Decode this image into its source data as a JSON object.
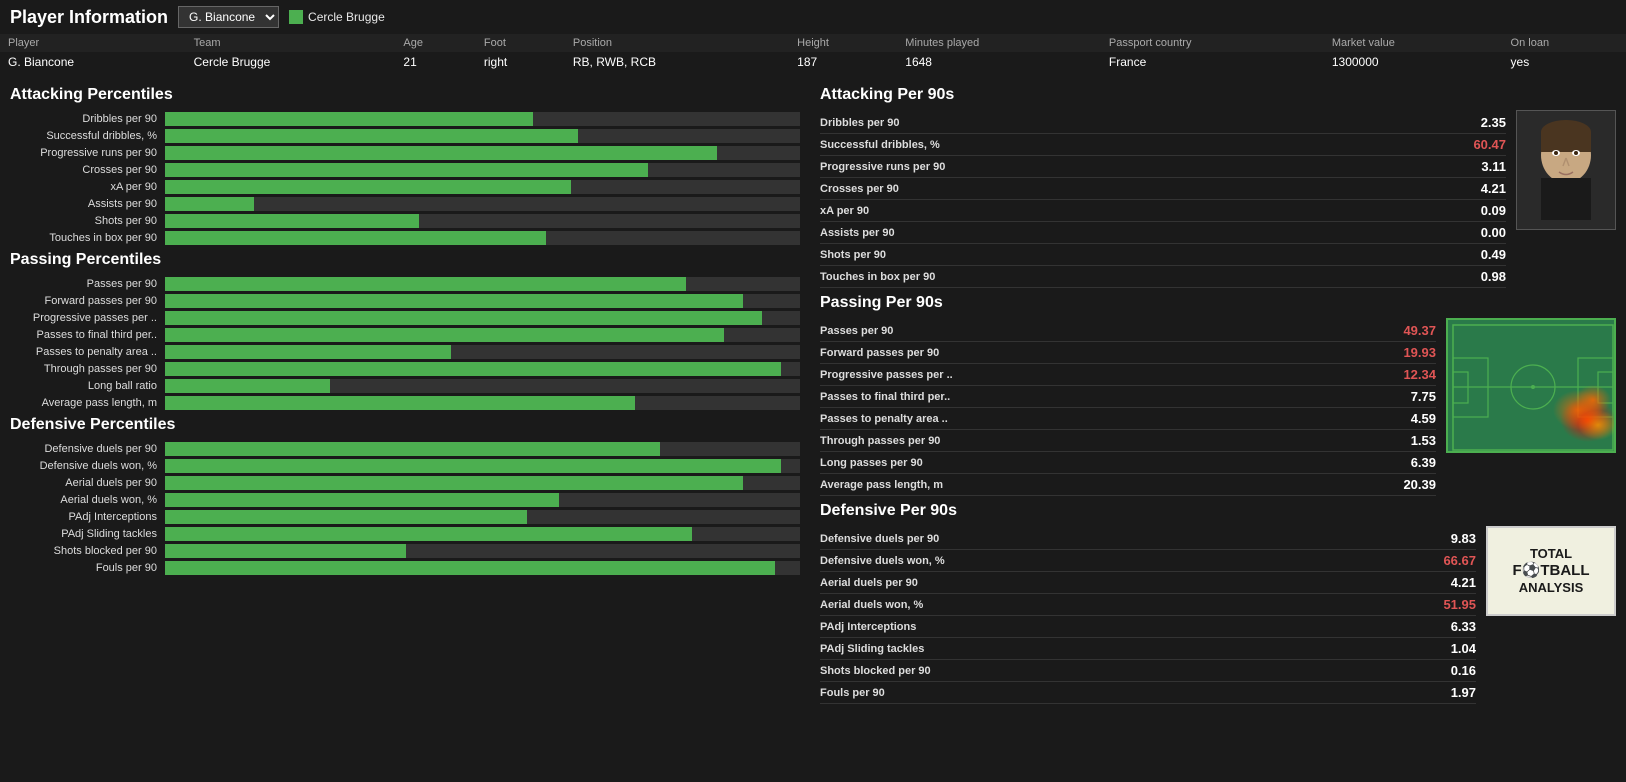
{
  "header": {
    "title": "Player Information",
    "player_selector": "G. Biancone",
    "team_name": "Cercle Brugge"
  },
  "player_info": {
    "labels": [
      "Player",
      "Team",
      "Age",
      "Foot",
      "Position",
      "Height",
      "Minutes played",
      "Passport country",
      "Market value",
      "On loan"
    ],
    "values": [
      "G. Biancone",
      "Cercle Brugge",
      "21",
      "right",
      "RB, RWB, RCB",
      "187",
      "1648",
      "France",
      "1300000",
      "yes"
    ]
  },
  "attacking_percentiles": {
    "title": "Attacking Percentiles",
    "bars": [
      {
        "label": "Dribbles per 90",
        "pct": 58
      },
      {
        "label": "Successful dribbles, %",
        "pct": 65
      },
      {
        "label": "Progressive runs per 90",
        "pct": 87
      },
      {
        "label": "Crosses per 90",
        "pct": 76
      },
      {
        "label": "xA per 90",
        "pct": 64
      },
      {
        "label": "Assists per 90",
        "pct": 14
      },
      {
        "label": "Shots per 90",
        "pct": 40
      },
      {
        "label": "Touches in box per 90",
        "pct": 60
      }
    ]
  },
  "attacking_per90": {
    "title": "Attacking Per 90s",
    "stats": [
      {
        "label": "Dribbles per 90",
        "value": "2.35",
        "red": false
      },
      {
        "label": "Successful dribbles, %",
        "value": "60.47",
        "red": true
      },
      {
        "label": "Progressive runs per 90",
        "value": "3.11",
        "red": false
      },
      {
        "label": "Crosses per 90",
        "value": "4.21",
        "red": false
      },
      {
        "label": "xA per 90",
        "value": "0.09",
        "red": false
      },
      {
        "label": "Assists per 90",
        "value": "0.00",
        "red": false
      },
      {
        "label": "Shots per 90",
        "value": "0.49",
        "red": false
      },
      {
        "label": "Touches in box per 90",
        "value": "0.98",
        "red": false
      }
    ]
  },
  "passing_percentiles": {
    "title": "Passing Percentiles",
    "bars": [
      {
        "label": "Passes per 90",
        "pct": 82
      },
      {
        "label": "Forward passes per 90",
        "pct": 91
      },
      {
        "label": "Progressive passes per ..",
        "pct": 94
      },
      {
        "label": "Passes to final third per..",
        "pct": 88
      },
      {
        "label": "Passes to penalty area ..",
        "pct": 45
      },
      {
        "label": "Through passes per 90",
        "pct": 97
      },
      {
        "label": "Long ball ratio",
        "pct": 26
      },
      {
        "label": "Average pass length, m",
        "pct": 74
      }
    ]
  },
  "passing_per90": {
    "title": "Passing Per 90s",
    "stats": [
      {
        "label": "Passes per 90",
        "value": "49.37",
        "red": true
      },
      {
        "label": "Forward passes per 90",
        "value": "19.93",
        "red": true
      },
      {
        "label": "Progressive passes per ..",
        "value": "12.34",
        "red": true
      },
      {
        "label": "Passes to final third per..",
        "value": "7.75",
        "red": false
      },
      {
        "label": "Passes to penalty area ..",
        "value": "4.59",
        "red": false
      },
      {
        "label": "Through passes per 90",
        "value": "1.53",
        "red": false
      },
      {
        "label": "Long passes per 90",
        "value": "6.39",
        "red": false
      },
      {
        "label": "Average pass length, m",
        "value": "20.39",
        "red": false
      }
    ]
  },
  "defensive_percentiles": {
    "title": "Defensive Percentiles",
    "bars": [
      {
        "label": "Defensive duels per 90",
        "pct": 78
      },
      {
        "label": "Defensive duels won, %",
        "pct": 97
      },
      {
        "label": "Aerial duels per 90",
        "pct": 91
      },
      {
        "label": "Aerial duels won, %",
        "pct": 62
      },
      {
        "label": "PAdj Interceptions",
        "pct": 57
      },
      {
        "label": "PAdj Sliding tackles",
        "pct": 83
      },
      {
        "label": "Shots blocked per 90",
        "pct": 38
      },
      {
        "label": "Fouls per 90",
        "pct": 96
      }
    ]
  },
  "defensive_per90": {
    "title": "Defensive Per 90s",
    "stats": [
      {
        "label": "Defensive duels per 90",
        "value": "9.83",
        "red": false
      },
      {
        "label": "Defensive duels won, %",
        "value": "66.67",
        "red": true
      },
      {
        "label": "Aerial duels per 90",
        "value": "4.21",
        "red": false
      },
      {
        "label": "Aerial duels won, %",
        "value": "51.95",
        "red": true
      },
      {
        "label": "PAdj Interceptions",
        "value": "6.33",
        "red": false
      },
      {
        "label": "PAdj Sliding tackles",
        "value": "1.04",
        "red": false
      },
      {
        "label": "Shots blocked per 90",
        "value": "0.16",
        "red": false
      },
      {
        "label": "Fouls per 90",
        "value": "1.97",
        "red": false
      }
    ]
  }
}
